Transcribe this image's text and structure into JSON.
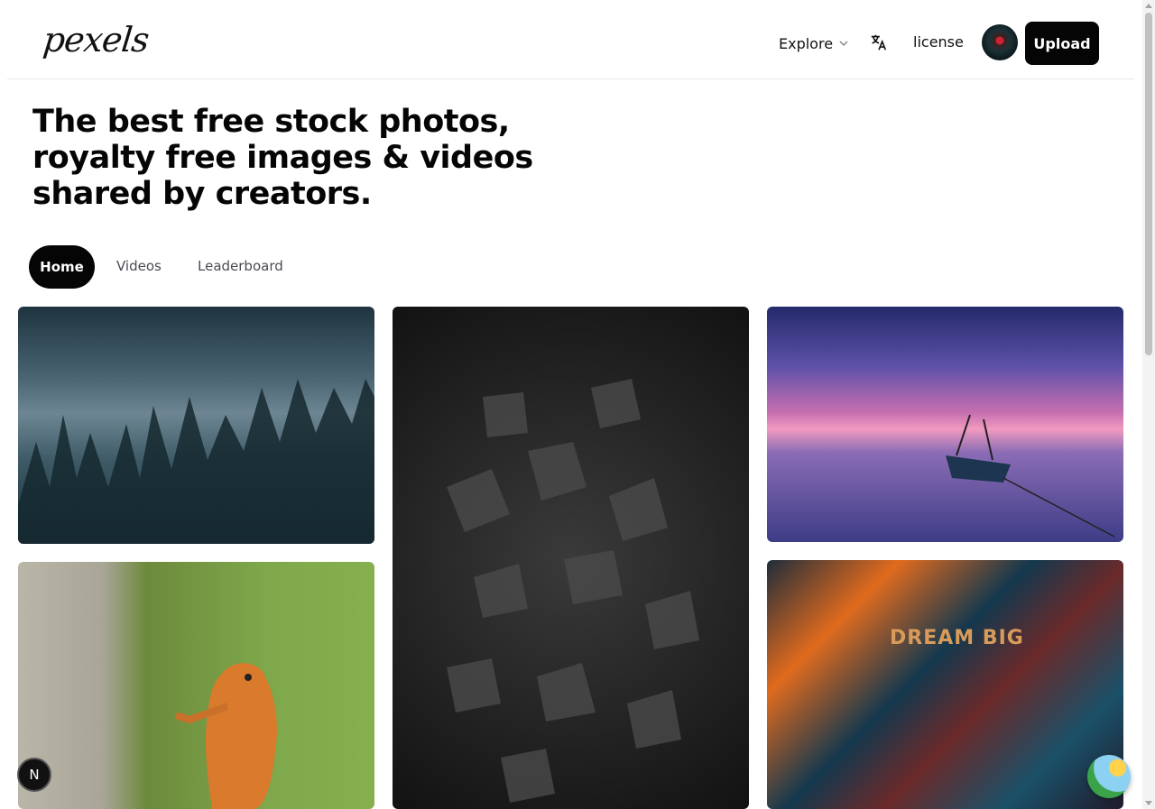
{
  "header": {
    "logo": "pexels",
    "explore_label": "Explore",
    "license_label": "license",
    "upload_label": "Upload"
  },
  "hero": {
    "title": "The best free stock photos, royalty free images & videos shared by creators."
  },
  "tabs": [
    {
      "label": "Home",
      "active": true
    },
    {
      "label": "Videos",
      "active": false
    },
    {
      "label": "Leaderboard",
      "active": false
    }
  ],
  "photos": [
    {
      "subject": "misty-forest"
    },
    {
      "subject": "black-rocks"
    },
    {
      "subject": "sunset-boat"
    },
    {
      "subject": "lizard-on-tree"
    },
    {
      "subject": "dream-big-collage",
      "overlay_text": "DREAM BIG"
    }
  ],
  "floating": {
    "next_badge": "N"
  },
  "colors": {
    "primary_button": "#050505",
    "secondary_text": "#4a4a55",
    "divider": "#e8e8e8"
  },
  "icons": [
    "chevron-down-icon",
    "translate-icon"
  ]
}
